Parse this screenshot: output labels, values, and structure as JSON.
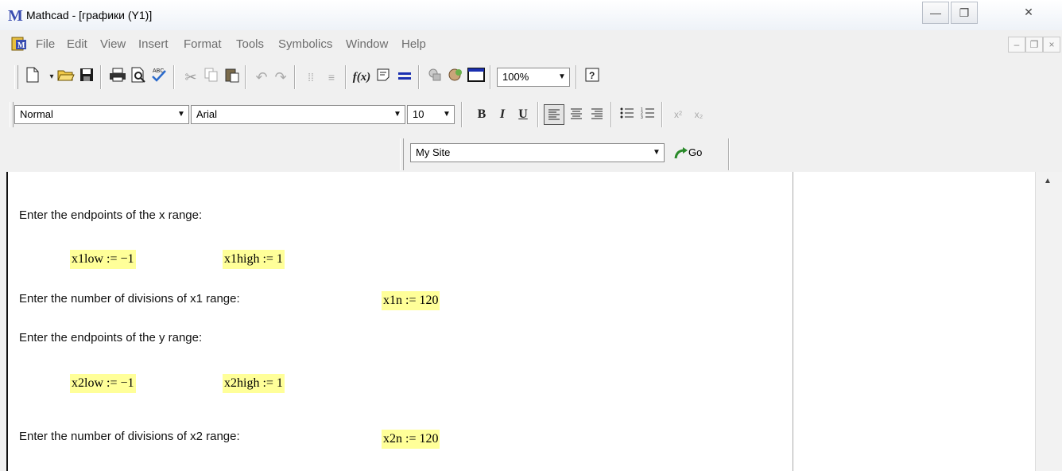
{
  "window": {
    "title": "Mathcad - [графики (Y1)]",
    "minimize_glyph": "—",
    "restore_glyph": "❐",
    "close_glyph": "✕",
    "logo_letter": "M"
  },
  "menu": {
    "items": [
      "File",
      "Edit",
      "View",
      "Insert",
      "Format",
      "Tools",
      "Symbolics",
      "Window",
      "Help"
    ],
    "mdi_minimize": "–",
    "mdi_restore": "❐",
    "mdi_close": "×"
  },
  "toolbar_standard": {
    "zoom_value": "100%",
    "icons": [
      "new-document-icon",
      "dropdown-arrow-icon",
      "open-folder-icon",
      "save-icon",
      "print-icon",
      "print-preview-icon",
      "spell-check-icon",
      "cut-icon",
      "copy-icon",
      "paste-icon",
      "undo-icon",
      "redo-icon",
      "align-horizontal-icon",
      "align-vertical-icon",
      "insert-function-icon",
      "insert-unit-icon",
      "calculate-icon",
      "resources-icon",
      "component-icon",
      "region-icon",
      "help-icon"
    ]
  },
  "toolbar_format": {
    "style_value": "Normal",
    "font_value": "Arial",
    "size_value": "10",
    "bold_label": "B",
    "italic_label": "I",
    "underline_label": "U",
    "superscript_label": "x²",
    "subscript_label": "x₂"
  },
  "toolbar_web": {
    "site_value": "My Site",
    "go_label": "Go"
  },
  "document": {
    "lines": [
      "Enter the endpoints of the x range:",
      "Enter the number of divisions of x1 range:",
      "Enter the endpoints of the y range:",
      "Enter the number of divisions of x2 range:"
    ],
    "math": {
      "x1low": "x1low := −1",
      "x1high": "x1high := 1",
      "x1n": "x1n := 120",
      "x2low": "x2low := −1",
      "x2high": "x2high := 1",
      "x2n": "x2n := 120"
    }
  },
  "colors": {
    "math_highlight": "#ffff99",
    "menu_text": "#6d6d6d",
    "workspace": "#ffffff"
  }
}
